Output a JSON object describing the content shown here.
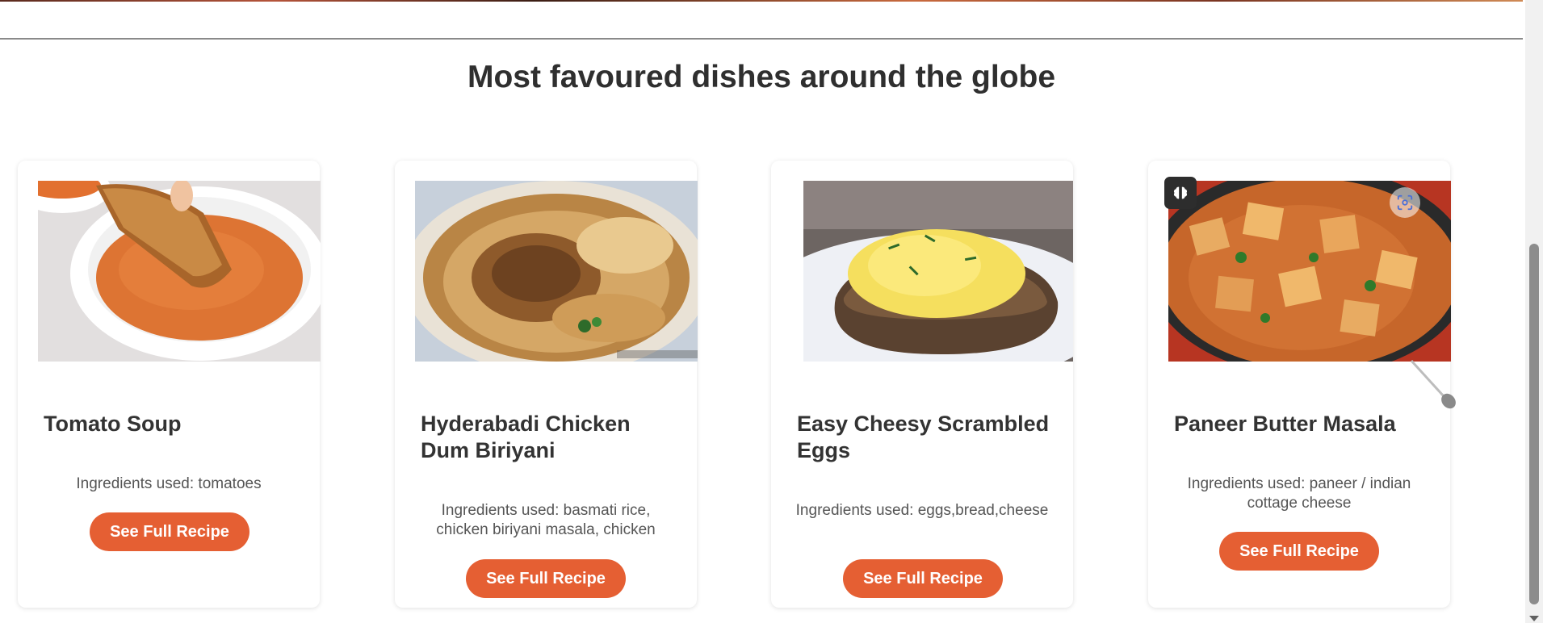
{
  "section": {
    "title": "Most favoured dishes around the globe"
  },
  "cards": [
    {
      "title": "Tomato Soup",
      "ingredients": "Ingredients used: tomatoes",
      "button_label": "See Full Recipe",
      "image_icon": "tomato-soup-photo"
    },
    {
      "title": "Hyderabadi Chicken Dum Biriyani",
      "ingredients": "Ingredients used: basmati rice, chicken biriyani masala, chicken",
      "button_label": "See Full Recipe",
      "image_icon": "biriyani-photo"
    },
    {
      "title": "Easy Cheesy Scrambled Eggs",
      "ingredients": "Ingredients used: eggs,bread,cheese",
      "button_label": "See Full Recipe",
      "image_icon": "scrambled-eggs-photo"
    },
    {
      "title": "Paneer Butter Masala",
      "ingredients": "Ingredients used: paneer / indian cottage cheese",
      "button_label": "See Full Recipe",
      "image_icon": "paneer-masala-photo"
    }
  ],
  "colors": {
    "accent": "#e55f33",
    "title": "#2f2f2f",
    "text": "#555555"
  },
  "icons": {
    "image_overlay_left": "ai-brain-icon",
    "image_overlay_right": "visual-search-icon"
  }
}
